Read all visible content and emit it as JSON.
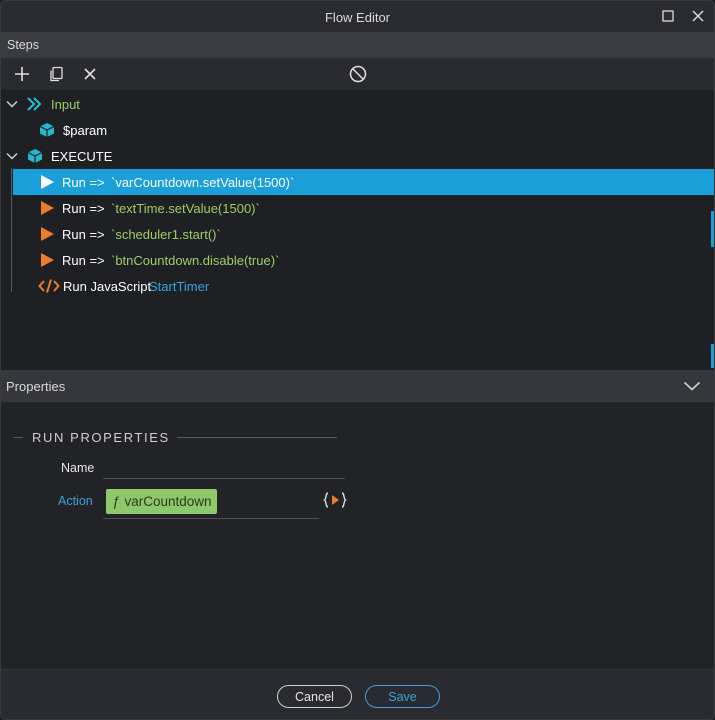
{
  "window": {
    "title": "Flow Editor"
  },
  "steps": {
    "header": "Steps"
  },
  "tree": {
    "input_label": "Input",
    "param_label": "$param",
    "execute_label": "EXECUTE",
    "items": [
      {
        "prefix": "Run => ",
        "code": "`varCountdown.setValue(1500)`"
      },
      {
        "prefix": "Run => ",
        "code": "`textTime.setValue(1500)`"
      },
      {
        "prefix": "Run => ",
        "code": "`scheduler1.start()`"
      },
      {
        "prefix": "Run => ",
        "code": "`btnCountdown.disable(true)`"
      }
    ],
    "js_item": {
      "prefix": "Run JavaScript ",
      "name": "StartTimer"
    }
  },
  "properties": {
    "header": "Properties",
    "section_title": "RUN PROPERTIES",
    "name_label": "Name",
    "name_value": "",
    "action_label": "Action",
    "action_chip_symbol": "ƒ",
    "action_chip_value": "varCountdown"
  },
  "footer": {
    "cancel_label": "Cancel",
    "save_label": "Save"
  },
  "colors": {
    "accent": "#1a9fd9",
    "green": "#9bcf66",
    "orange": "#f07b2a",
    "chip": "#8fc86a"
  },
  "icons": {
    "maximize": "maximize-icon",
    "close": "close-icon",
    "add": "plus-icon",
    "copy": "copy-icon",
    "delete": "x-icon",
    "disable": "ban-icon",
    "input": "double-chevron-icon",
    "param": "cube-icon",
    "execute": "cube-icon",
    "run": "play-icon",
    "javascript": "code-icon",
    "collapse": "chevron-down-icon",
    "expression": "expression-icon"
  }
}
